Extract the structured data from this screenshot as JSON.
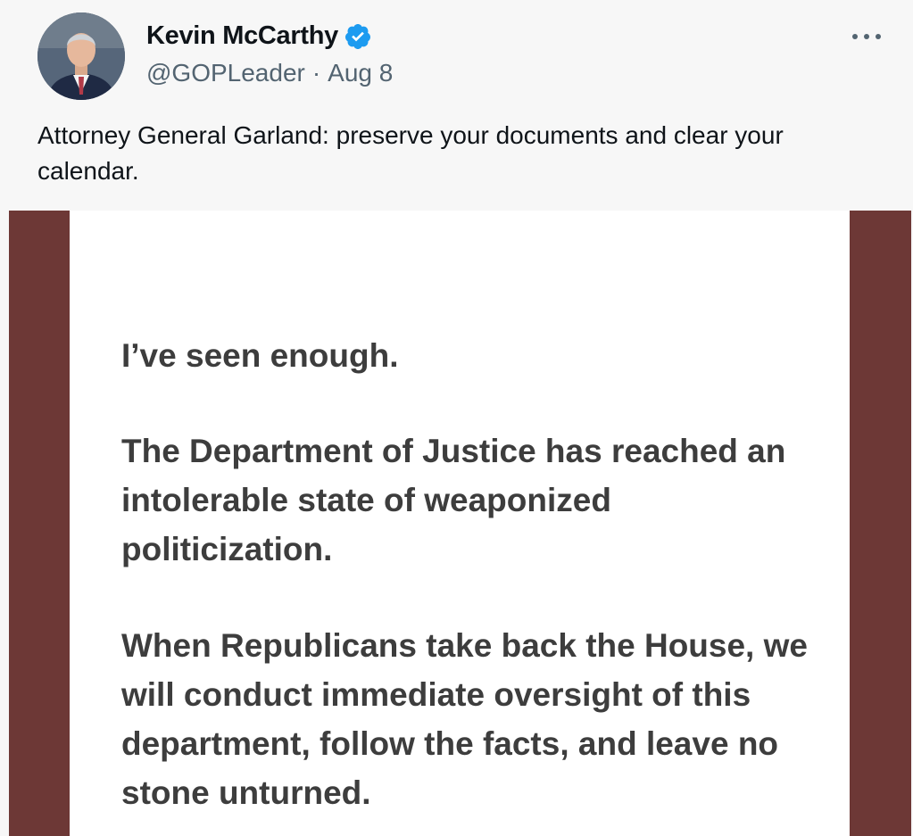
{
  "author": {
    "display_name": "Kevin McCarthy",
    "handle": "@GOPLeader",
    "separator": "·",
    "date": "Aug 8",
    "verified": true
  },
  "tweet": {
    "text": "Attorney General Garland: preserve your documents and clear your calendar."
  },
  "media": {
    "paragraphs": [
      "I’ve seen enough.",
      "The Department of Justice has reached an intolerable state of weaponized politicization.",
      "When Republicans take back the House, we will conduct immediate oversight of this department, follow the facts, and leave no stone unturned."
    ]
  },
  "icons": {
    "verified": "verified-badge-icon",
    "more": "more-options-icon"
  },
  "colors": {
    "verified_badge": "#1d9bf0",
    "media_border": "#6d3836",
    "statement_text": "#3d3d3d",
    "secondary_text": "#536471"
  }
}
